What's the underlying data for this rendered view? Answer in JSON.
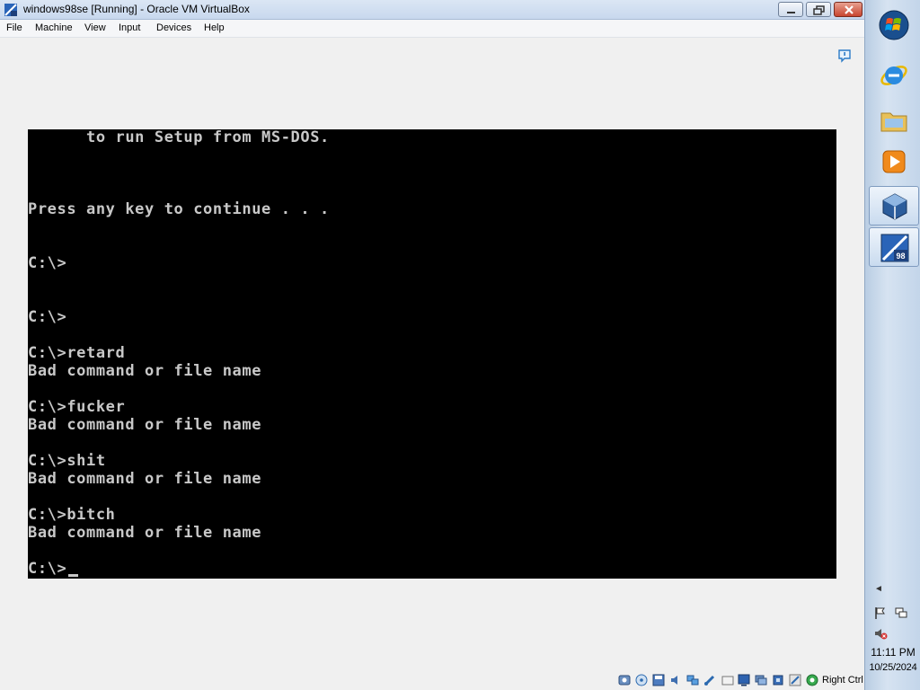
{
  "window": {
    "title": "windows98se [Running] - Oracle VM VirtualBox"
  },
  "menu": {
    "items": [
      "File",
      "Machine",
      "View",
      "Input",
      "Devices",
      "Help"
    ]
  },
  "console": {
    "lines": [
      "      to run Setup from MS-DOS.",
      "",
      "",
      "",
      "Press any key to continue . . .",
      "",
      "",
      "C:\\>",
      "",
      "",
      "C:\\>",
      "",
      "C:\\>retard",
      "Bad command or file name",
      "",
      "C:\\>fucker",
      "Bad command or file name",
      "",
      "C:\\>shit",
      "Bad command or file name",
      "",
      "C:\\>bitch",
      "Bad command or file name",
      "",
      "C:\\>"
    ]
  },
  "statusbar": {
    "host_key": "Right Ctrl"
  },
  "taskbar": {
    "start_icon": "windows-orb-icon",
    "pinned": [
      "internet-explorer-icon",
      "windows-explorer-icon",
      "media-player-icon",
      "virtualbox-icon",
      "windows98-icon"
    ],
    "clock_time": "11:11 PM",
    "clock_date": "10/25/2024"
  }
}
